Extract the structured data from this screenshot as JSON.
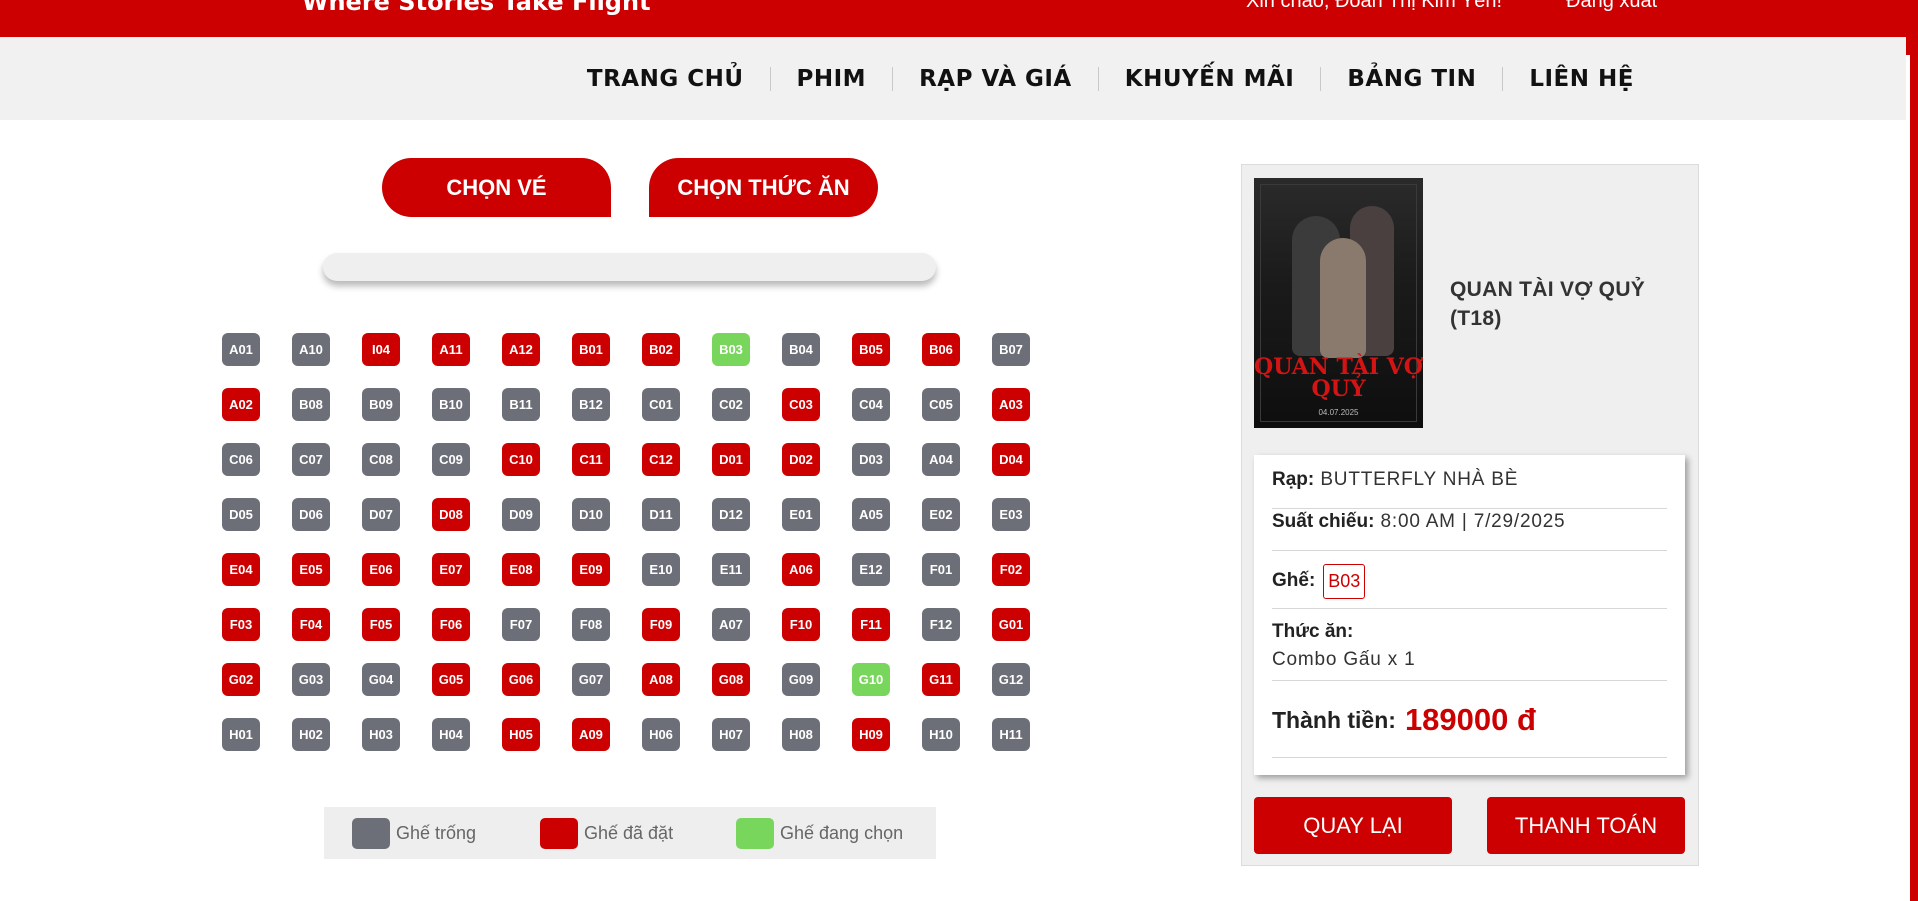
{
  "header": {
    "slogan": "Where Stories Take Flight",
    "greeting": "Xin chào, Đoàn Thị Kim Yến!",
    "logout": "Đăng xuất"
  },
  "nav": [
    "TRANG CHỦ",
    "PHIM",
    "RẠP VÀ GIÁ",
    "KHUYẾN MÃI",
    "BẢNG TIN",
    "LIÊN HỆ"
  ],
  "tabs": {
    "ticket": "CHỌN VÉ",
    "food": "CHỌN THỨC ĂN"
  },
  "colors": {
    "brand_red": "#cc0000",
    "seat_empty": "#6c6f78",
    "seat_booked": "#cc0000",
    "seat_selected": "#78d65c"
  },
  "seats": [
    {
      "id": "A01",
      "status": "empty"
    },
    {
      "id": "A10",
      "status": "empty"
    },
    {
      "id": "I04",
      "status": "booked"
    },
    {
      "id": "A11",
      "status": "booked"
    },
    {
      "id": "A12",
      "status": "booked"
    },
    {
      "id": "B01",
      "status": "booked"
    },
    {
      "id": "B02",
      "status": "booked"
    },
    {
      "id": "B03",
      "status": "selected"
    },
    {
      "id": "B04",
      "status": "empty"
    },
    {
      "id": "B05",
      "status": "booked"
    },
    {
      "id": "B06",
      "status": "booked"
    },
    {
      "id": "B07",
      "status": "empty"
    },
    {
      "id": "A02",
      "status": "booked"
    },
    {
      "id": "B08",
      "status": "empty"
    },
    {
      "id": "B09",
      "status": "empty"
    },
    {
      "id": "B10",
      "status": "empty"
    },
    {
      "id": "B11",
      "status": "empty"
    },
    {
      "id": "B12",
      "status": "empty"
    },
    {
      "id": "C01",
      "status": "empty"
    },
    {
      "id": "C02",
      "status": "empty"
    },
    {
      "id": "C03",
      "status": "booked"
    },
    {
      "id": "C04",
      "status": "empty"
    },
    {
      "id": "C05",
      "status": "empty"
    },
    {
      "id": "A03",
      "status": "booked"
    },
    {
      "id": "C06",
      "status": "empty"
    },
    {
      "id": "C07",
      "status": "empty"
    },
    {
      "id": "C08",
      "status": "empty"
    },
    {
      "id": "C09",
      "status": "empty"
    },
    {
      "id": "C10",
      "status": "booked"
    },
    {
      "id": "C11",
      "status": "booked"
    },
    {
      "id": "C12",
      "status": "booked"
    },
    {
      "id": "D01",
      "status": "booked"
    },
    {
      "id": "D02",
      "status": "booked"
    },
    {
      "id": "D03",
      "status": "empty"
    },
    {
      "id": "A04",
      "status": "empty"
    },
    {
      "id": "D04",
      "status": "booked"
    },
    {
      "id": "D05",
      "status": "empty"
    },
    {
      "id": "D06",
      "status": "empty"
    },
    {
      "id": "D07",
      "status": "empty"
    },
    {
      "id": "D08",
      "status": "booked"
    },
    {
      "id": "D09",
      "status": "empty"
    },
    {
      "id": "D10",
      "status": "empty"
    },
    {
      "id": "D11",
      "status": "empty"
    },
    {
      "id": "D12",
      "status": "empty"
    },
    {
      "id": "E01",
      "status": "empty"
    },
    {
      "id": "A05",
      "status": "empty"
    },
    {
      "id": "E02",
      "status": "empty"
    },
    {
      "id": "E03",
      "status": "empty"
    },
    {
      "id": "E04",
      "status": "booked"
    },
    {
      "id": "E05",
      "status": "booked"
    },
    {
      "id": "E06",
      "status": "booked"
    },
    {
      "id": "E07",
      "status": "booked"
    },
    {
      "id": "E08",
      "status": "booked"
    },
    {
      "id": "E09",
      "status": "booked"
    },
    {
      "id": "E10",
      "status": "empty"
    },
    {
      "id": "E11",
      "status": "empty"
    },
    {
      "id": "A06",
      "status": "booked"
    },
    {
      "id": "E12",
      "status": "empty"
    },
    {
      "id": "F01",
      "status": "empty"
    },
    {
      "id": "F02",
      "status": "booked"
    },
    {
      "id": "F03",
      "status": "booked"
    },
    {
      "id": "F04",
      "status": "booked"
    },
    {
      "id": "F05",
      "status": "booked"
    },
    {
      "id": "F06",
      "status": "booked"
    },
    {
      "id": "F07",
      "status": "empty"
    },
    {
      "id": "F08",
      "status": "empty"
    },
    {
      "id": "F09",
      "status": "booked"
    },
    {
      "id": "A07",
      "status": "empty"
    },
    {
      "id": "F10",
      "status": "booked"
    },
    {
      "id": "F11",
      "status": "booked"
    },
    {
      "id": "F12",
      "status": "empty"
    },
    {
      "id": "G01",
      "status": "booked"
    },
    {
      "id": "G02",
      "status": "booked"
    },
    {
      "id": "G03",
      "status": "empty"
    },
    {
      "id": "G04",
      "status": "empty"
    },
    {
      "id": "G05",
      "status": "booked"
    },
    {
      "id": "G06",
      "status": "booked"
    },
    {
      "id": "G07",
      "status": "empty"
    },
    {
      "id": "A08",
      "status": "booked"
    },
    {
      "id": "G08",
      "status": "booked"
    },
    {
      "id": "G09",
      "status": "empty"
    },
    {
      "id": "G10",
      "status": "selected"
    },
    {
      "id": "G11",
      "status": "booked"
    },
    {
      "id": "G12",
      "status": "empty"
    },
    {
      "id": "H01",
      "status": "empty"
    },
    {
      "id": "H02",
      "status": "empty"
    },
    {
      "id": "H03",
      "status": "empty"
    },
    {
      "id": "H04",
      "status": "empty"
    },
    {
      "id": "H05",
      "status": "booked"
    },
    {
      "id": "A09",
      "status": "booked"
    },
    {
      "id": "H06",
      "status": "empty"
    },
    {
      "id": "H07",
      "status": "empty"
    },
    {
      "id": "H08",
      "status": "empty"
    },
    {
      "id": "H09",
      "status": "booked"
    },
    {
      "id": "H10",
      "status": "empty"
    },
    {
      "id": "H11",
      "status": "empty"
    }
  ],
  "legend": {
    "empty": "Ghế trống",
    "booked": "Ghế đã đặt",
    "selected": "Ghế đang chọn"
  },
  "booking": {
    "poster_title": "QUAN TÀI VỢ QUỶ",
    "poster_date": "04.07.2025",
    "movie_title": "QUAN TÀI VỢ QUỶ (T18)",
    "cinema_label": "Rạp:",
    "cinema_value": "BUTTERFLY NHÀ BÈ",
    "showtime_label": "Suất chiếu:",
    "showtime_value": "8:00 AM | 7/29/2025",
    "seat_label": "Ghế:",
    "seat_value": "B03",
    "food_label": "Thức ăn:",
    "food_value": "Combo Gấu x 1",
    "total_label": "Thành tiền:",
    "total_value": "189000 đ"
  },
  "buttons": {
    "back": "QUAY LẠI",
    "pay": "THANH TOÁN"
  }
}
